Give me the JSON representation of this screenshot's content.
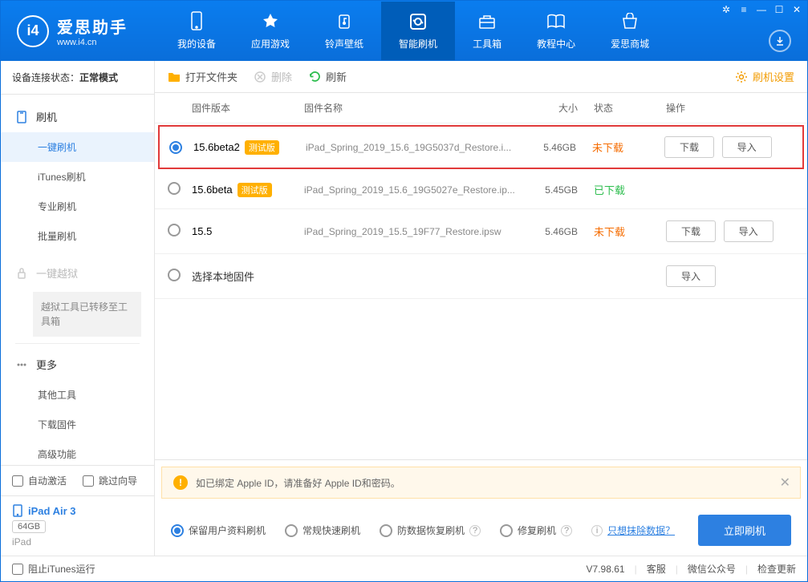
{
  "app": {
    "title": "爱思助手",
    "url": "www.i4.cn"
  },
  "nav": {
    "items": [
      {
        "label": "我的设备"
      },
      {
        "label": "应用游戏"
      },
      {
        "label": "铃声壁纸"
      },
      {
        "label": "智能刷机"
      },
      {
        "label": "工具箱"
      },
      {
        "label": "教程中心"
      },
      {
        "label": "爱思商城"
      }
    ]
  },
  "sidebar": {
    "conn_label": "设备连接状态：",
    "conn_value": "正常模式",
    "flash": {
      "title": "刷机",
      "items": [
        "一键刷机",
        "iTunes刷机",
        "专业刷机",
        "批量刷机"
      ]
    },
    "jailbreak": {
      "title": "一键越狱",
      "note": "越狱工具已转移至工具箱"
    },
    "more": {
      "title": "更多",
      "items": [
        "其他工具",
        "下载固件",
        "高级功能"
      ]
    },
    "auto_activate": "自动激活",
    "skip_guide": "跳过向导",
    "device_name": "iPad Air 3",
    "device_storage": "64GB",
    "device_type": "iPad"
  },
  "toolbar": {
    "open_folder": "打开文件夹",
    "delete": "删除",
    "refresh": "刷新",
    "settings": "刷机设置"
  },
  "table": {
    "headers": {
      "version": "固件版本",
      "name": "固件名称",
      "size": "大小",
      "status": "状态",
      "action": "操作"
    },
    "rows": [
      {
        "selected": true,
        "highlighted": true,
        "version": "15.6beta2",
        "beta": "测试版",
        "name": "iPad_Spring_2019_15.6_19G5037d_Restore.i...",
        "size": "5.46GB",
        "status": "未下载",
        "status_color": "red",
        "actions": [
          "下载",
          "导入"
        ]
      },
      {
        "selected": false,
        "version": "15.6beta",
        "beta": "测试版",
        "name": "iPad_Spring_2019_15.6_19G5027e_Restore.ip...",
        "size": "5.45GB",
        "status": "已下载",
        "status_color": "green",
        "actions": []
      },
      {
        "selected": false,
        "version": "15.5",
        "beta": "",
        "name": "iPad_Spring_2019_15.5_19F77_Restore.ipsw",
        "size": "5.46GB",
        "status": "未下载",
        "status_color": "red",
        "actions": [
          "下载",
          "导入"
        ]
      },
      {
        "selected": false,
        "version": "选择本地固件",
        "beta": "",
        "name": "",
        "size": "",
        "status": "",
        "status_color": "",
        "actions": [
          "导入"
        ]
      }
    ]
  },
  "warn": {
    "text": "如已绑定 Apple ID，请准备好 Apple ID和密码。"
  },
  "options": {
    "o1": "保留用户资料刷机",
    "o2": "常规快速刷机",
    "o3": "防数据恢复刷机",
    "o4": "修复刷机",
    "link": "只想抹除数据？",
    "primary": "立即刷机"
  },
  "footer": {
    "block_itunes": "阻止iTunes运行",
    "version": "V7.98.61",
    "service": "客服",
    "wechat": "微信公众号",
    "update": "检查更新"
  }
}
